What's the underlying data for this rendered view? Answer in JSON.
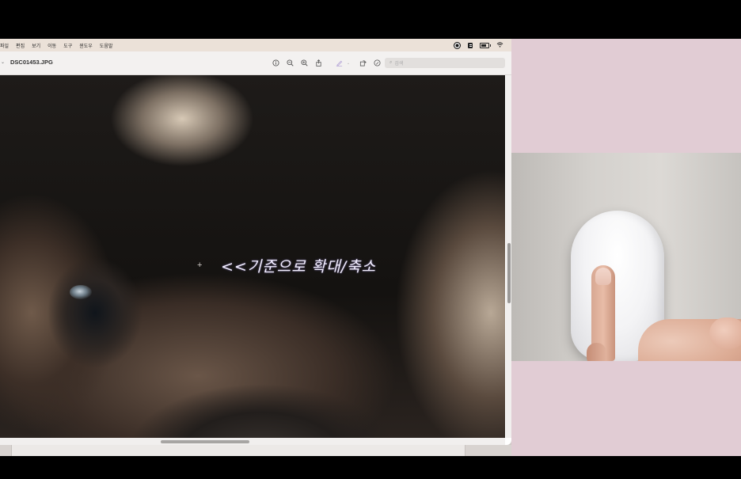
{
  "menubar": {
    "items": [
      "파일",
      "편집",
      "보기",
      "이동",
      "도구",
      "윈도우",
      "도움말"
    ]
  },
  "window": {
    "title": "DSC01453.JPG",
    "search_placeholder": "검색"
  },
  "overlay": {
    "annotation": "<<기준으로 확대/축소"
  },
  "icons": {
    "info": "info-icon",
    "zoom_out": "zoom-out-icon",
    "zoom_in": "zoom-in-icon",
    "share": "share-icon",
    "markup": "pen-icon",
    "rotate": "rotate-icon",
    "annotate": "markup-icon"
  }
}
